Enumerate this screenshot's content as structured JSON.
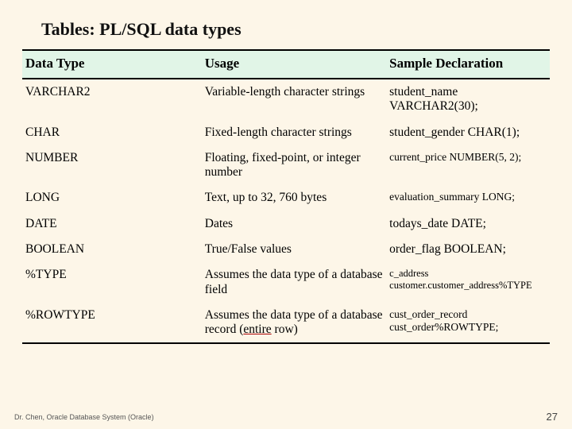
{
  "title": "Tables: PL/SQL data types",
  "headers": {
    "c1": "Data Type",
    "c2": "Usage",
    "c3": "Sample Declaration"
  },
  "rows": [
    {
      "type": "VARCHAR2",
      "usage": "Variable-length character strings",
      "sample": "student_name VARCHAR2(30);"
    },
    {
      "type": "CHAR",
      "usage": "Fixed-length character strings",
      "sample": "student_gender CHAR(1);"
    },
    {
      "type": "NUMBER",
      "usage": "Floating, fixed-point, or integer number",
      "sample": "current_price NUMBER(5, 2);",
      "sample_small": true
    },
    {
      "type": "LONG",
      "usage": "Text, up to 32, 760 bytes",
      "sample": "evaluation_summary LONG;",
      "sample_small": true
    },
    {
      "type": "DATE",
      "usage": "Dates",
      "sample": "todays_date DATE;"
    },
    {
      "type": "BOOLEAN",
      "usage": "True/False values",
      "sample": "order_flag BOOLEAN;"
    },
    {
      "type": "%TYPE",
      "usage": "Assumes the data type of a database field",
      "sample": "c_address customer.customer_address%TYPE",
      "sample_smaller": true
    },
    {
      "type": "%ROWTYPE",
      "usage_pre": "Assumes the data type of a database record (",
      "usage_u": "entire",
      "usage_post": " row)",
      "sample": "cust_order_record cust_order%ROWTYPE;",
      "sample_small": true
    }
  ],
  "footer_left": "Dr. Chen, Oracle Database System (Oracle)",
  "footer_right": "27"
}
